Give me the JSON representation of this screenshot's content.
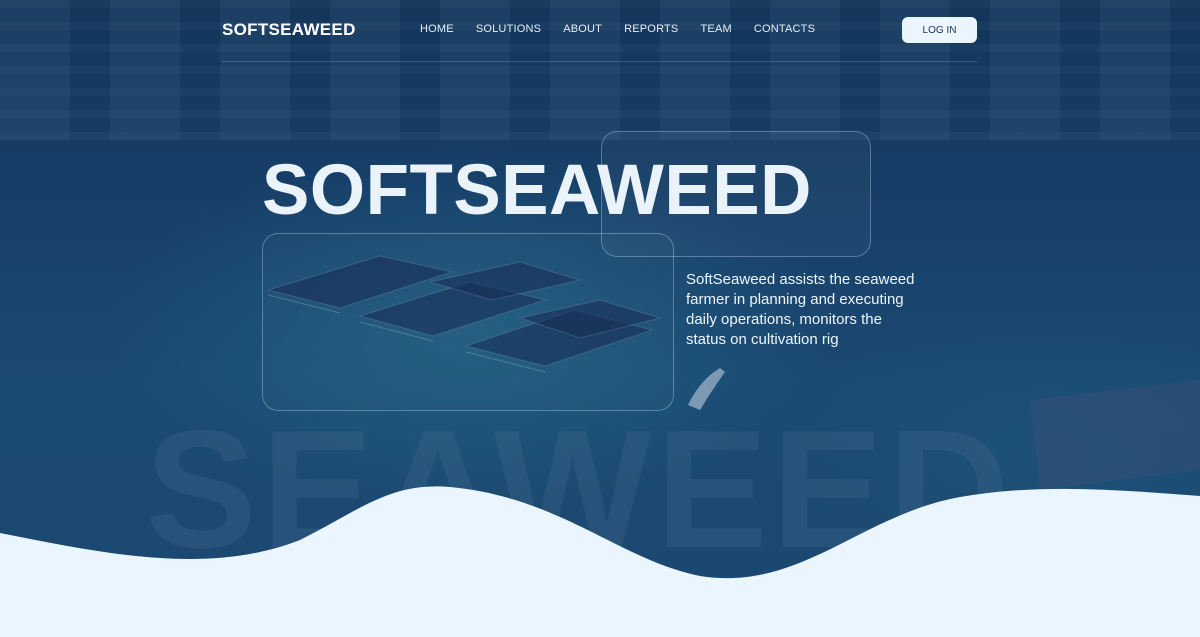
{
  "brand": {
    "logo_text": "SOFTSEAWEED"
  },
  "nav": {
    "items": [
      {
        "label": "HOME"
      },
      {
        "label": "SOLUTIONS"
      },
      {
        "label": "ABOUT"
      },
      {
        "label": "REPORTS"
      },
      {
        "label": "TEAM"
      },
      {
        "label": "CONTACTS"
      }
    ],
    "login_label": "LOG IN"
  },
  "hero": {
    "title": "SOFTSEAWEED",
    "description": "SoftSeaweed assists the seaweed farmer in planning and executing daily operations, monitors the status on cultivation rig",
    "background_word": "SEAWEED"
  },
  "colors": {
    "sea_dark": "#14355a",
    "sea": "#1b4870",
    "wave_fill": "#eaf5fe",
    "button_bg": "#eaf5fe",
    "button_text": "#1a3354"
  }
}
